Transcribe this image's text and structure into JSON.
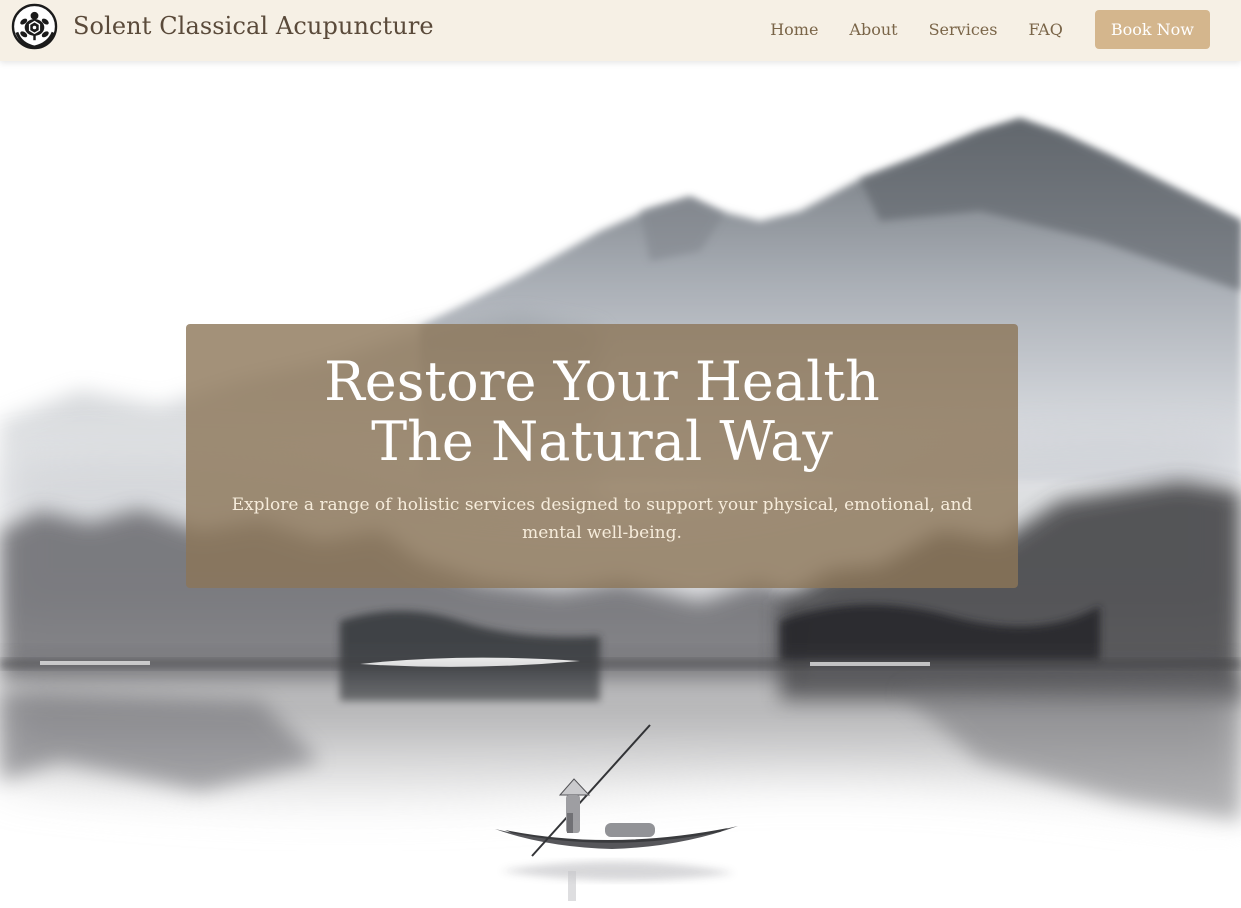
{
  "brand": {
    "name": "Solent Classical Acupuncture",
    "logo_icon": "turtle-logo-icon"
  },
  "nav": {
    "links": [
      {
        "label": "Home"
      },
      {
        "label": "About"
      },
      {
        "label": "Services"
      },
      {
        "label": "FAQ"
      }
    ],
    "cta_label": "Book Now"
  },
  "hero": {
    "title_line1": "Restore Your Health",
    "title_line2": "The Natural Way",
    "subtitle": "Explore a range of holistic services designed to support your physical, emotional, and mental well-being.",
    "background_icon": "ink-mountain-lake-boat-illustration"
  },
  "colors": {
    "navbar_bg": "#f6f0e5",
    "brand_text": "#5a4a3a",
    "nav_text": "#7a6548",
    "cta_bg": "#d4b68d",
    "hero_panel": "#8c7658",
    "hero_subtitle": "#f6ecdb"
  }
}
